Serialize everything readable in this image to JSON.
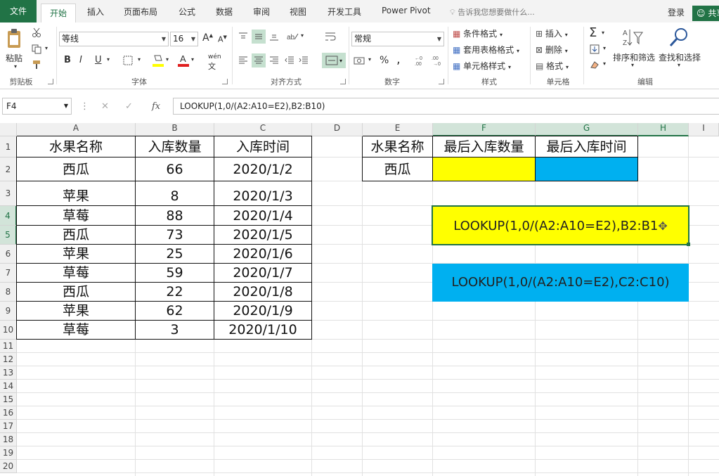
{
  "tabs": {
    "file": "文件",
    "home": "开始",
    "insert": "插入",
    "page_layout": "页面布局",
    "formulas": "公式",
    "data": "数据",
    "review": "审阅",
    "view": "视图",
    "developer": "开发工具",
    "power_pivot": "Power Pivot",
    "tell_me": "告诉我您想要做什么...",
    "login": "登录",
    "share": "共享"
  },
  "ribbon": {
    "clipboard": {
      "paste": "粘贴",
      "label": "剪贴板"
    },
    "font": {
      "name": "等线",
      "size": "16",
      "label": "字体",
      "bold": "B",
      "italic": "I",
      "underline": "U",
      "grow": "A",
      "shrink": "A",
      "phonetic": "wén"
    },
    "alignment": {
      "label": "对齐方式"
    },
    "number": {
      "format": "常规",
      "label": "数字",
      "percent": "%"
    },
    "styles": {
      "conditional": "条件格式",
      "table": "套用表格格式",
      "cell": "单元格样式",
      "label": "样式"
    },
    "cells": {
      "insert": "插入",
      "delete": "删除",
      "format": "格式",
      "label": "单元格"
    },
    "editing": {
      "sort": "排序和筛选",
      "find": "查找和选择",
      "label": "编辑"
    }
  },
  "formula_bar": {
    "name_box": "F4",
    "formula": "LOOKUP(1,0/(A2:A10=E2),B2:B10)"
  },
  "columns": [
    "A",
    "B",
    "C",
    "D",
    "E",
    "F",
    "G",
    "H",
    "I"
  ],
  "rows": [
    "1",
    "2",
    "3",
    "4",
    "5",
    "6",
    "7",
    "8",
    "9",
    "10",
    "11",
    "12",
    "13",
    "14",
    "15",
    "16",
    "17",
    "18",
    "19",
    "20"
  ],
  "table": {
    "headers": [
      "水果名称",
      "入库数量",
      "入库时间"
    ],
    "rows": [
      [
        "西瓜",
        "66",
        "2020/1/2"
      ],
      [
        "苹果",
        "8",
        "2020/1/3"
      ],
      [
        "草莓",
        "88",
        "2020/1/4"
      ],
      [
        "西瓜",
        "73",
        "2020/1/5"
      ],
      [
        "苹果",
        "25",
        "2020/1/6"
      ],
      [
        "草莓",
        "59",
        "2020/1/7"
      ],
      [
        "西瓜",
        "22",
        "2020/1/8"
      ],
      [
        "苹果",
        "62",
        "2020/1/9"
      ],
      [
        "草莓",
        "3",
        "2020/1/10"
      ]
    ]
  },
  "lookup": {
    "headers": [
      "水果名称",
      "最后入库数量",
      "最后入库时间"
    ],
    "key": "西瓜"
  },
  "annotations": {
    "qty_formula": "LOOKUP(1,0/(A2:A10=E2),B2:B1",
    "time_formula": "LOOKUP(1,0/(A2:A10=E2),C2:C10)"
  },
  "colors": {
    "excel_green": "#217346",
    "yellow": "#ffff00",
    "cyan": "#00b0f0"
  }
}
